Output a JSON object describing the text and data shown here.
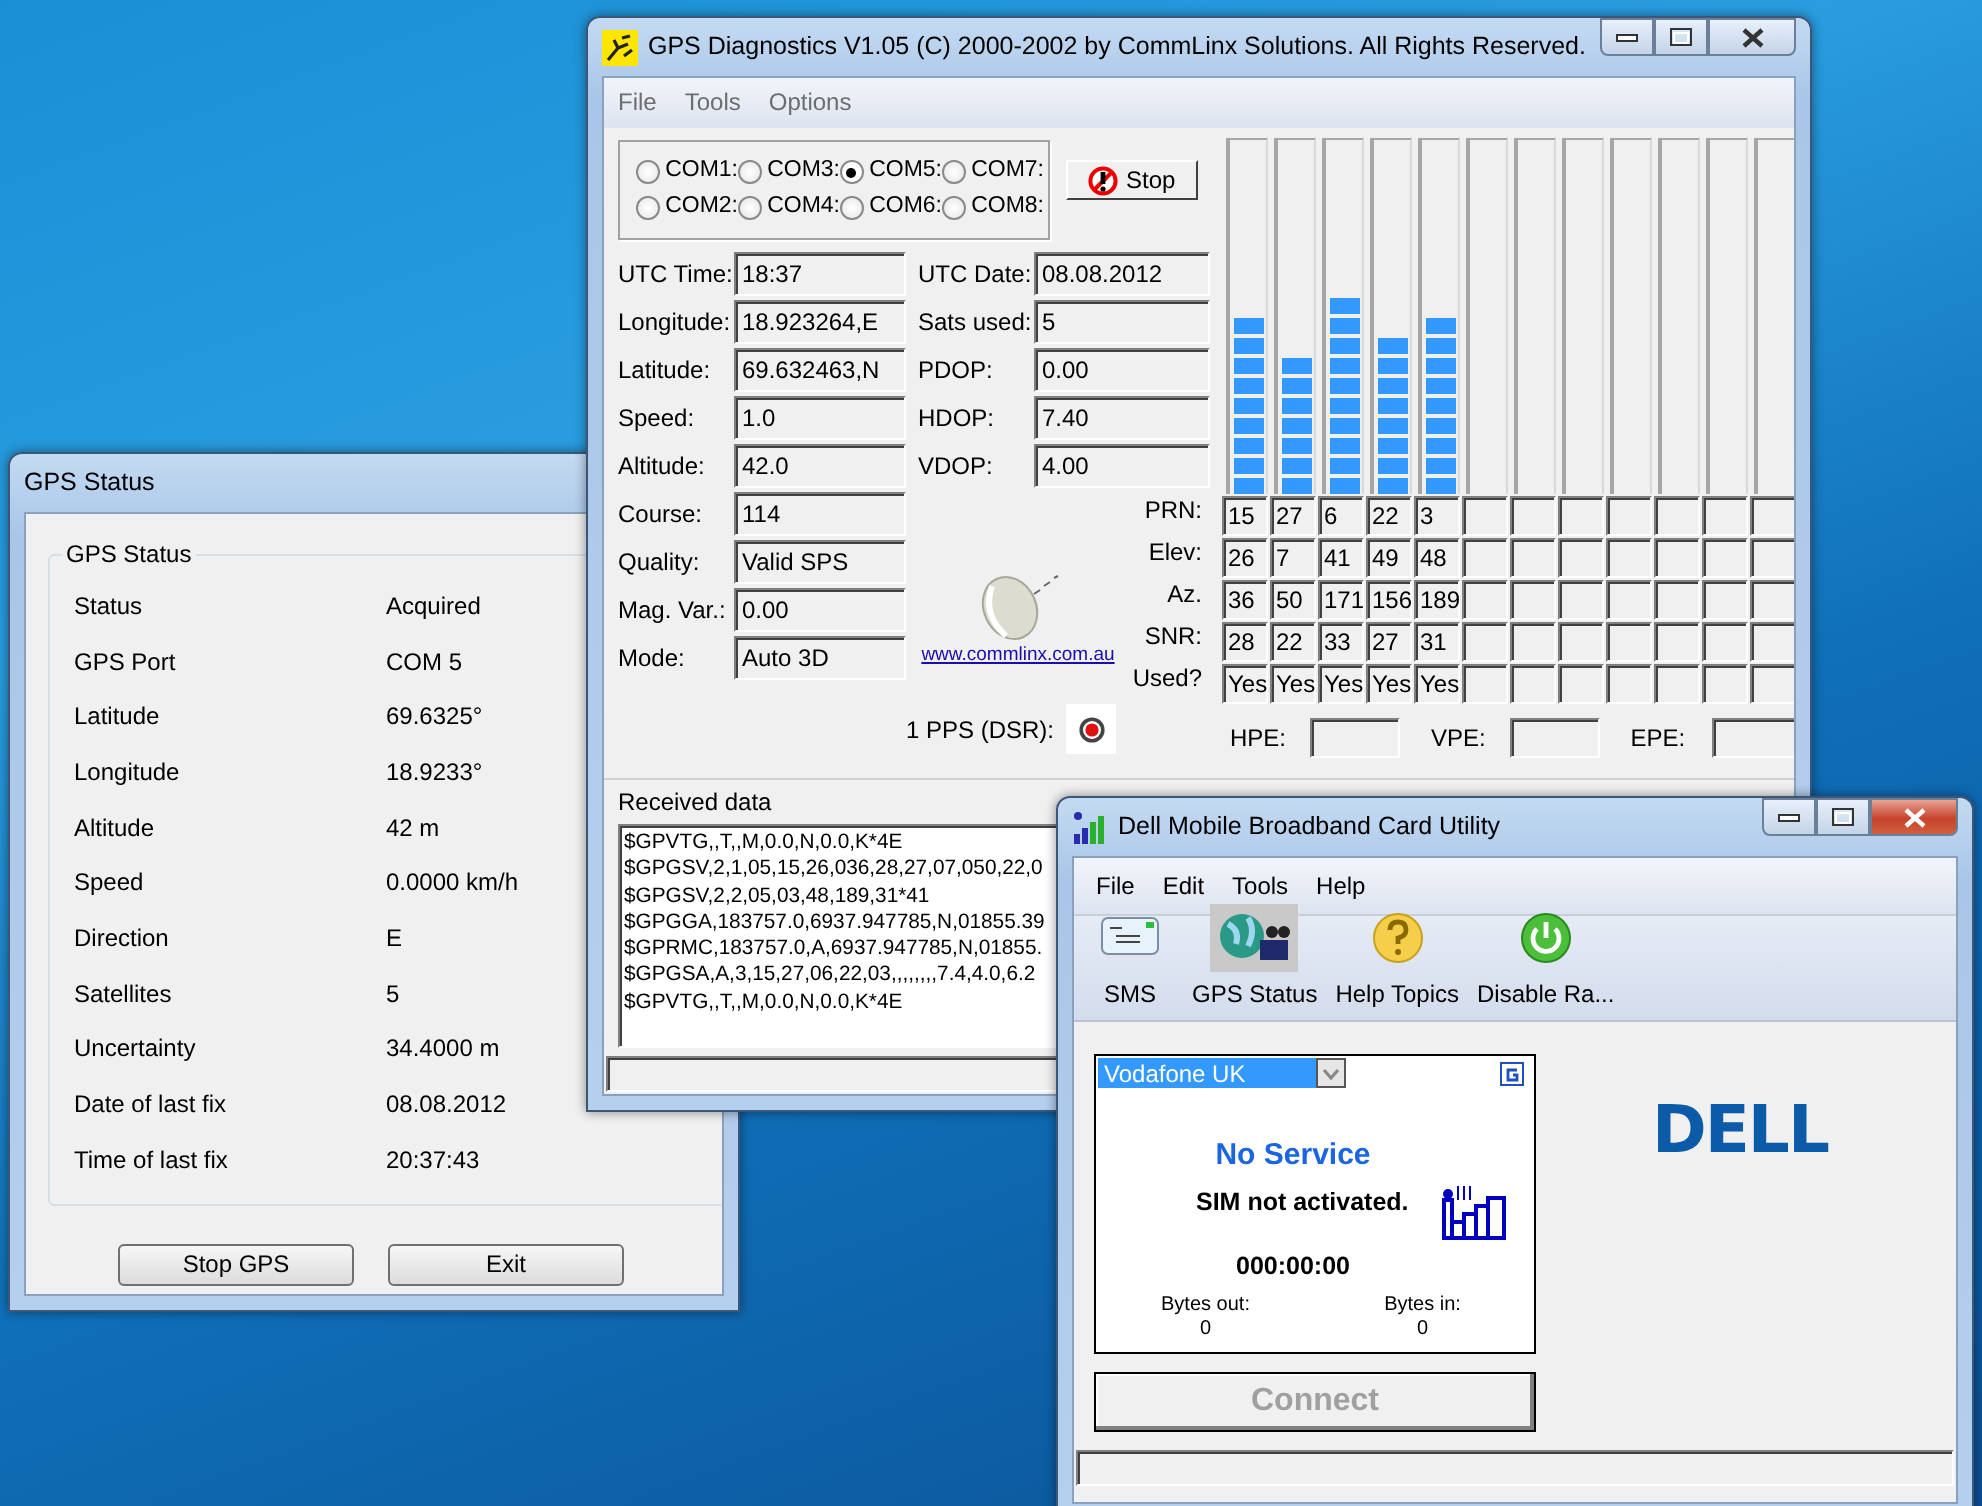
{
  "gps_status_window": {
    "title": "GPS Status",
    "group_title": "GPS Status",
    "rows": [
      {
        "label": "Status",
        "value": "Acquired"
      },
      {
        "label": "GPS Port",
        "value": "COM 5"
      },
      {
        "label": "Latitude",
        "value": "69.6325°"
      },
      {
        "label": "Longitude",
        "value": "18.9233°"
      },
      {
        "label": "Altitude",
        "value": "42 m"
      },
      {
        "label": "Speed",
        "value": "0.0000 km/h"
      },
      {
        "label": "Direction",
        "value": "E"
      },
      {
        "label": "Satellites",
        "value": "5"
      },
      {
        "label": "Uncertainty",
        "value": "34.4000 m"
      },
      {
        "label": "Date of last fix",
        "value": "08.08.2012"
      },
      {
        "label": "Time of last fix",
        "value": "20:37:43"
      }
    ],
    "buttons": [
      "Stop GPS",
      "Exit"
    ]
  },
  "diagnostics_window": {
    "title": "GPS Diagnostics V1.05 (C) 2000-2002 by CommLinx Solutions. All Rights Reserved.",
    "menu": [
      "File",
      "Tools",
      "Options"
    ],
    "ports": [
      {
        "label": "COM1:",
        "selected": false
      },
      {
        "label": "COM2:",
        "selected": false
      },
      {
        "label": "COM3:",
        "selected": false
      },
      {
        "label": "COM4:",
        "selected": false
      },
      {
        "label": "COM5:",
        "selected": true
      },
      {
        "label": "COM6:",
        "selected": false
      },
      {
        "label": "COM7:",
        "selected": false
      },
      {
        "label": "COM8:",
        "selected": false
      }
    ],
    "stop_button": "Stop",
    "fields_left": [
      {
        "label": "UTC Time:",
        "value": "18:37"
      },
      {
        "label": "Longitude:",
        "value": "18.923264,E"
      },
      {
        "label": "Latitude:",
        "value": "69.632463,N"
      },
      {
        "label": "Speed:",
        "value": "1.0"
      },
      {
        "label": "Altitude:",
        "value": "42.0"
      },
      {
        "label": "Course:",
        "value": "114"
      },
      {
        "label": "Quality:",
        "value": "Valid SPS"
      },
      {
        "label": "Mag. Var.:",
        "value": "0.00"
      },
      {
        "label": "Mode:",
        "value": "Auto 3D"
      }
    ],
    "fields_right": [
      {
        "label": "UTC Date:",
        "value": "08.08.2012"
      },
      {
        "label": "Sats used:",
        "value": "5"
      },
      {
        "label": "PDOP:",
        "value": "0.00"
      },
      {
        "label": "HDOP:",
        "value": "7.40"
      },
      {
        "label": "VDOP:",
        "value": "4.00"
      }
    ],
    "website": "www.commlinx.com.au",
    "pps_label": "1 PPS (DSR):",
    "table_labels": [
      "PRN:",
      "Elev:",
      "Az.",
      "SNR:",
      "Used?"
    ],
    "satellites": [
      {
        "prn": "15",
        "elev": "26",
        "az": "36",
        "snr": "28",
        "used": "Yes",
        "level": 0.5
      },
      {
        "prn": "27",
        "elev": "7",
        "az": "50",
        "snr": "22",
        "used": "Yes",
        "level": 0.39
      },
      {
        "prn": "6",
        "elev": "41",
        "az": "171",
        "snr": "33",
        "used": "Yes",
        "level": 0.56
      },
      {
        "prn": "22",
        "elev": "49",
        "az": "156",
        "snr": "27",
        "used": "Yes",
        "level": 0.45
      },
      {
        "prn": "3",
        "elev": "48",
        "az": "189",
        "snr": "31",
        "used": "Yes",
        "level": 0.5
      }
    ],
    "error_labels": [
      "HPE:",
      "VPE:",
      "EPE:"
    ],
    "received_label": "Received data",
    "received_lines": [
      "$GPVTG,,T,,M,0.0,N,0.0,K*4E",
      "$GPGSV,2,1,05,15,26,036,28,27,07,050,22,0",
      "$GPGSV,2,2,05,03,48,189,31*41",
      "$GPGGA,183757.0,6937.947785,N,01855.39",
      "$GPRMC,183757.0,A,6937.947785,N,01855.",
      "$GPGSA,A,3,15,27,06,22,03,,,,,,,,7.4,4.0,6.2",
      "$GPVTG,,T,,M,0.0,N,0.0,K*4E"
    ]
  },
  "dell_window": {
    "title": "Dell Mobile Broadband Card Utility",
    "menu": [
      "File",
      "Edit",
      "Tools",
      "Help"
    ],
    "toolbar": [
      {
        "label": "SMS",
        "kind": "sms",
        "selected": false
      },
      {
        "label": "GPS Status",
        "kind": "gps",
        "selected": true
      },
      {
        "label": "Help Topics",
        "kind": "help",
        "selected": false
      },
      {
        "label": "Disable Ra...",
        "kind": "power",
        "selected": false
      }
    ],
    "network": "Vodafone UK",
    "status": "No Service",
    "message": "SIM not activated.",
    "timer": "000:00:00",
    "bytes": [
      {
        "label": "Bytes out:",
        "value": "0"
      },
      {
        "label": "Bytes in:",
        "value": "0"
      }
    ],
    "connect": {
      "label": "Connect",
      "disabled": true
    },
    "logo": "DELL"
  }
}
